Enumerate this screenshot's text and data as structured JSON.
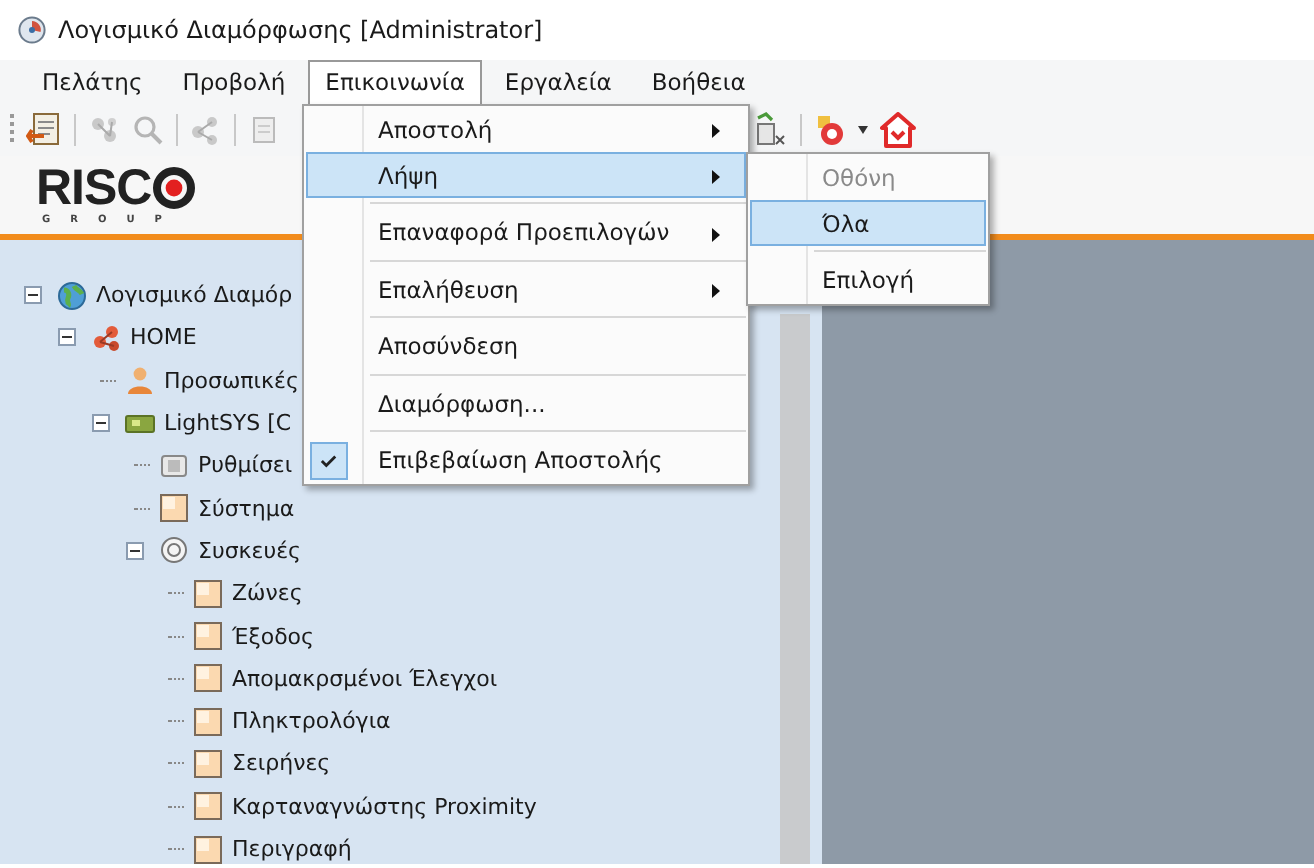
{
  "window": {
    "title": "Λογισμικό Διαμόρφωσης [Administrator]"
  },
  "menu_bar": [
    {
      "label": "Πελάτης",
      "selected": false
    },
    {
      "label": "Προβολή",
      "selected": false
    },
    {
      "label": "Επικοινωνία",
      "selected": true
    },
    {
      "label": "Εργαλεία",
      "selected": false
    },
    {
      "label": "Βοήθεια",
      "selected": false
    }
  ],
  "logo": {
    "brand": "RISC",
    "tagline": "GROUP"
  },
  "tree": [
    {
      "label": "Λογισμικό Διαμόρ",
      "kind": "root",
      "expanded": true,
      "children": [
        {
          "label": "HOME",
          "kind": "site",
          "expanded": true,
          "children": [
            {
              "label": "Προσωπικές",
              "kind": "user"
            },
            {
              "label": "LightSYS [C",
              "kind": "panel",
              "expanded": true,
              "children": [
                {
                  "label": "Ρυθμίσει",
                  "kind": "settings"
                },
                {
                  "label": "Σύστημα",
                  "kind": "page"
                },
                {
                  "label": "Συσκευές",
                  "kind": "devices",
                  "expanded": true,
                  "children": [
                    {
                      "label": "Ζώνες",
                      "kind": "page"
                    },
                    {
                      "label": "Έξοδος",
                      "kind": "page"
                    },
                    {
                      "label": "Απομακρσμένοι Έλεγχοι",
                      "kind": "page"
                    },
                    {
                      "label": "Πληκτρολόγια",
                      "kind": "page"
                    },
                    {
                      "label": "Σειρήνες",
                      "kind": "page"
                    },
                    {
                      "label": "Καρταναγνώστης Proximity",
                      "kind": "page"
                    },
                    {
                      "label": "Περιγραφή",
                      "kind": "page"
                    }
                  ]
                }
              ]
            }
          ]
        }
      ]
    }
  ],
  "dropdown": {
    "items": [
      {
        "kind": "item",
        "label": "Αποστολή",
        "submenu": true,
        "selected": false,
        "checked": false
      },
      {
        "kind": "item",
        "label": "Λήψη",
        "submenu": true,
        "selected": true,
        "checked": false
      },
      {
        "kind": "separator"
      },
      {
        "kind": "item",
        "label": "Επαναφορά Προεπιλογών",
        "submenu": true,
        "selected": false,
        "checked": false
      },
      {
        "kind": "separator"
      },
      {
        "kind": "item",
        "label": "Επαλήθευση",
        "submenu": true,
        "selected": false,
        "checked": false
      },
      {
        "kind": "separator"
      },
      {
        "kind": "item",
        "label": "Αποσύνδεση",
        "submenu": false,
        "selected": false,
        "checked": false
      },
      {
        "kind": "separator"
      },
      {
        "kind": "item",
        "label": "Διαμόρφωση...",
        "submenu": false,
        "selected": false,
        "checked": false
      },
      {
        "kind": "separator"
      },
      {
        "kind": "item",
        "label": "Επιβεβαίωση Αποστολής",
        "submenu": false,
        "selected": false,
        "checked": true
      }
    ]
  },
  "submenu": {
    "items": [
      {
        "kind": "item",
        "label": "Οθόνη",
        "selected": false,
        "disabled": true
      },
      {
        "kind": "item",
        "label": "Όλα",
        "selected": true,
        "disabled": false
      },
      {
        "kind": "separator"
      },
      {
        "kind": "item",
        "label": "Επιλογή",
        "selected": false,
        "disabled": false
      }
    ]
  }
}
